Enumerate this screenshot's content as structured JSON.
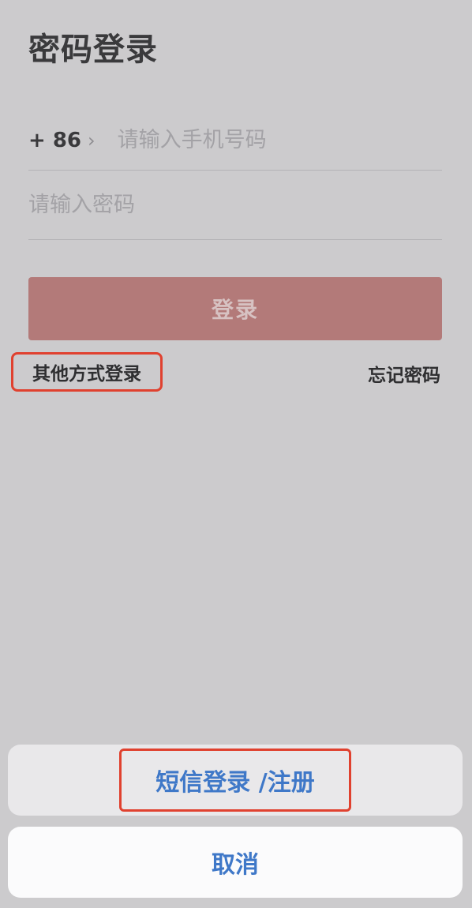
{
  "header": {
    "title": "密码登录"
  },
  "form": {
    "country_code": "+ 86",
    "chevron": "›",
    "phone_placeholder": "请输入手机号码",
    "password_placeholder": "请输入密码",
    "login_label": "登录"
  },
  "links": {
    "other_login": "其他方式登录",
    "forgot_password": "忘记密码"
  },
  "action_sheet": {
    "option_label": "短信登录 /注册",
    "cancel_label": "取消"
  },
  "colors": {
    "background": "#cccbcd",
    "login_button": "#b37a79",
    "highlight_border": "#e0412f",
    "action_text": "#3f78c8"
  }
}
